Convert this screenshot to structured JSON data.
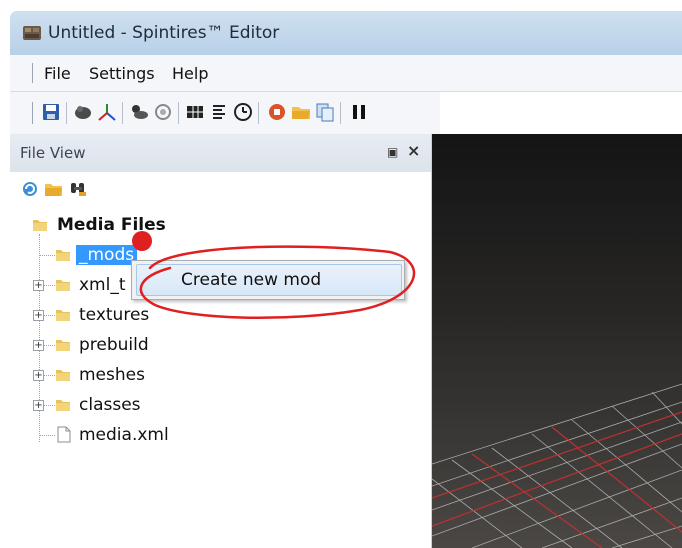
{
  "window": {
    "title": "Untitled - Spintires™ Editor",
    "icon": "spintires-app-icon"
  },
  "menubar": {
    "items": [
      "File",
      "Settings",
      "Help"
    ]
  },
  "toolbar": {
    "buttons": [
      {
        "icon": "save-icon"
      },
      {
        "icon": "terrain-brush-icon"
      },
      {
        "icon": "axis-gizmo-icon"
      },
      {
        "icon": "weather-icon"
      },
      {
        "icon": "hand-tool-icon"
      },
      {
        "icon": "grid-icon"
      },
      {
        "icon": "list-icon"
      },
      {
        "icon": "clock-icon"
      },
      {
        "icon": "stop-icon"
      },
      {
        "icon": "open-folder-icon"
      },
      {
        "icon": "copy-icon"
      },
      {
        "icon": "pause-icon"
      }
    ]
  },
  "file_view": {
    "title": "File View",
    "pin_glyph": "◀",
    "close_glyph": "×",
    "toolbar_icons": [
      "refresh-icon",
      "open-folder-icon",
      "binoculars-icon"
    ],
    "tree": {
      "root": "Media Files",
      "children": [
        {
          "label": "_mods",
          "selected": true
        },
        {
          "label": "xml_t"
        },
        {
          "label": "textures"
        },
        {
          "label": "prebuild"
        },
        {
          "label": "meshes"
        },
        {
          "label": "classes"
        },
        {
          "label": "media.xml"
        }
      ]
    }
  },
  "context_menu": {
    "items": [
      "Create new mod"
    ]
  },
  "annotation_color": "#e02020"
}
